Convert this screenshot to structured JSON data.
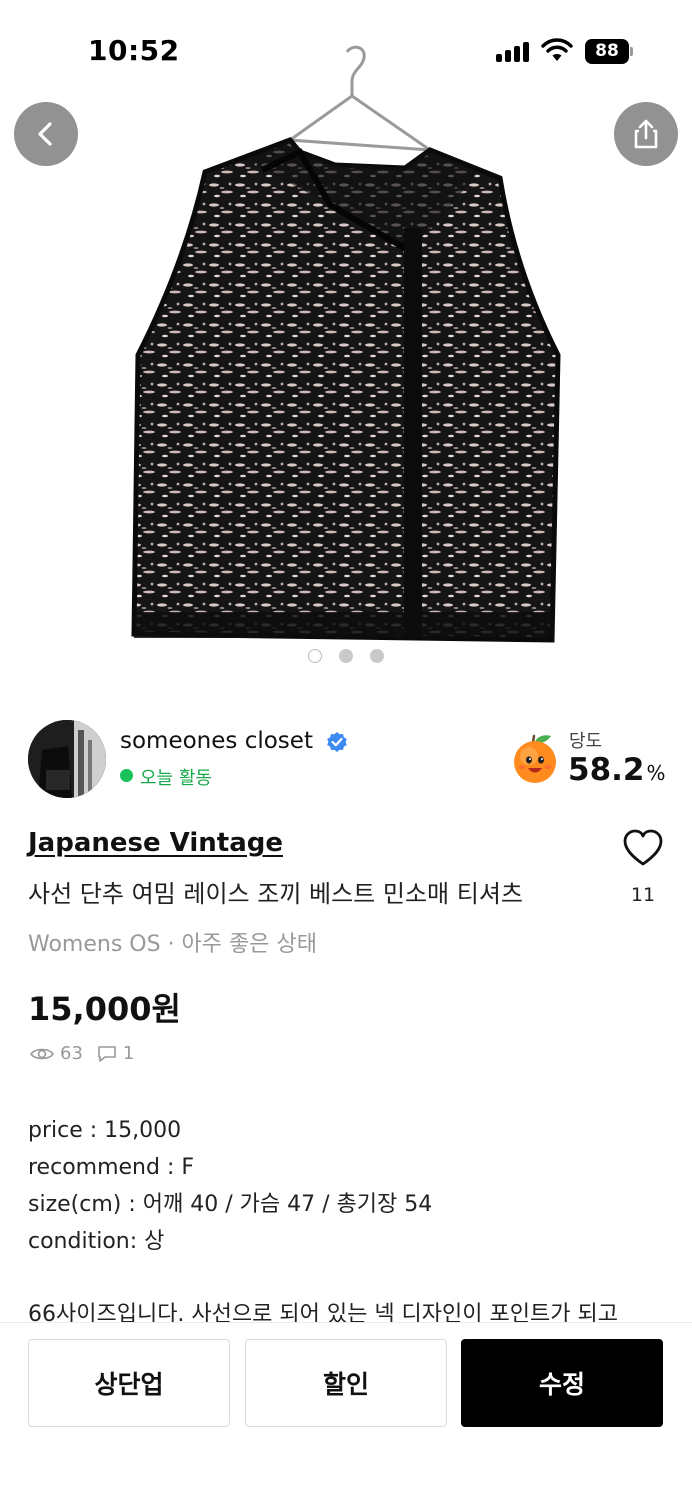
{
  "status_bar": {
    "time": "10:52",
    "battery": "88"
  },
  "hero": {
    "image_count": 3,
    "active_index": 0
  },
  "seller": {
    "name": "someones closet",
    "activity": "오늘 활동",
    "sweetness_label": "당도",
    "sweetness_value": "58.2",
    "sweetness_unit": "%"
  },
  "product": {
    "brand": "Japanese Vintage",
    "title": "사선 단추 여밈 레이스 조끼 베스트 민소매 티셔츠",
    "meta": "Womens OS · 아주 좋은 상태",
    "price": "15,000원",
    "likes": "11",
    "views": "63",
    "comments": "1"
  },
  "description": {
    "lines": [
      "price : 15,000",
      "recommend : F",
      "size(cm) : 어깨 40 / 가슴 47 / 총기장 54",
      "condition: 상"
    ],
    "extra": "66사이즈입니다. 사선으로 되어 있는 넥 디자인이 포인트가 되고"
  },
  "actions": {
    "bump": "상단업",
    "discount": "할인",
    "edit": "수정"
  },
  "colors": {
    "accent_green": "#19c15a",
    "verified_blue": "#3d8bf2",
    "primary_button": "#000000"
  }
}
